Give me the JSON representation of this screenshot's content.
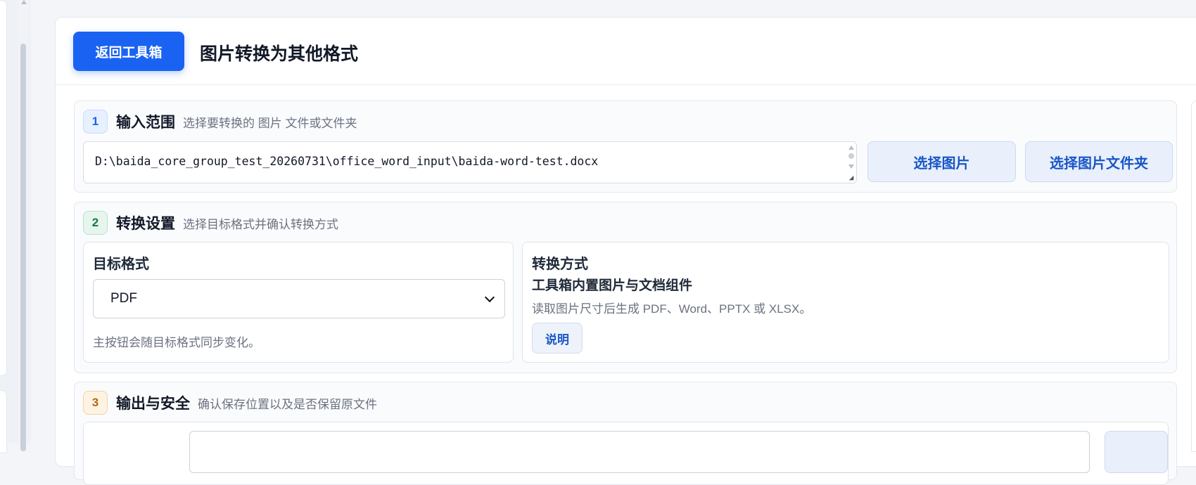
{
  "header": {
    "back_label": "返回工具箱",
    "title": "图片转换为其他格式"
  },
  "step1": {
    "number": "1",
    "title": "输入范围",
    "desc": "选择要转换的 图片 文件或文件夹",
    "path_value": "D:\\baida_core_group_test_20260731\\office_word_input\\baida-word-test.docx",
    "pick_label": "选择图片",
    "folder_label": "选择图片文件夹"
  },
  "step2": {
    "number": "2",
    "title": "转换设置",
    "desc": "选择目标格式并确认转换方式",
    "format_label": "目标格式",
    "format_selected": "PDF",
    "format_hint": "主按钮会随目标格式同步变化。",
    "method_label": "转换方式",
    "method_name": "工具箱内置图片与文档组件",
    "method_desc": "读取图片尺寸后生成 PDF、Word、PPTX 或 XLSX。",
    "explain_label": "说明"
  },
  "step3": {
    "number": "3",
    "title": "输出与安全",
    "desc": "确认保存位置以及是否保留原文件"
  },
  "colors": {
    "primary": "#1a63f2",
    "light_button": "#e9f0fc",
    "step1_badge": "#e7f0ff",
    "step2_badge": "#e6f6ee",
    "step3_badge": "#fdf3e2"
  },
  "icons": {
    "select_arrow": "chevron-down-icon",
    "resize": "resize-grip-icon"
  }
}
